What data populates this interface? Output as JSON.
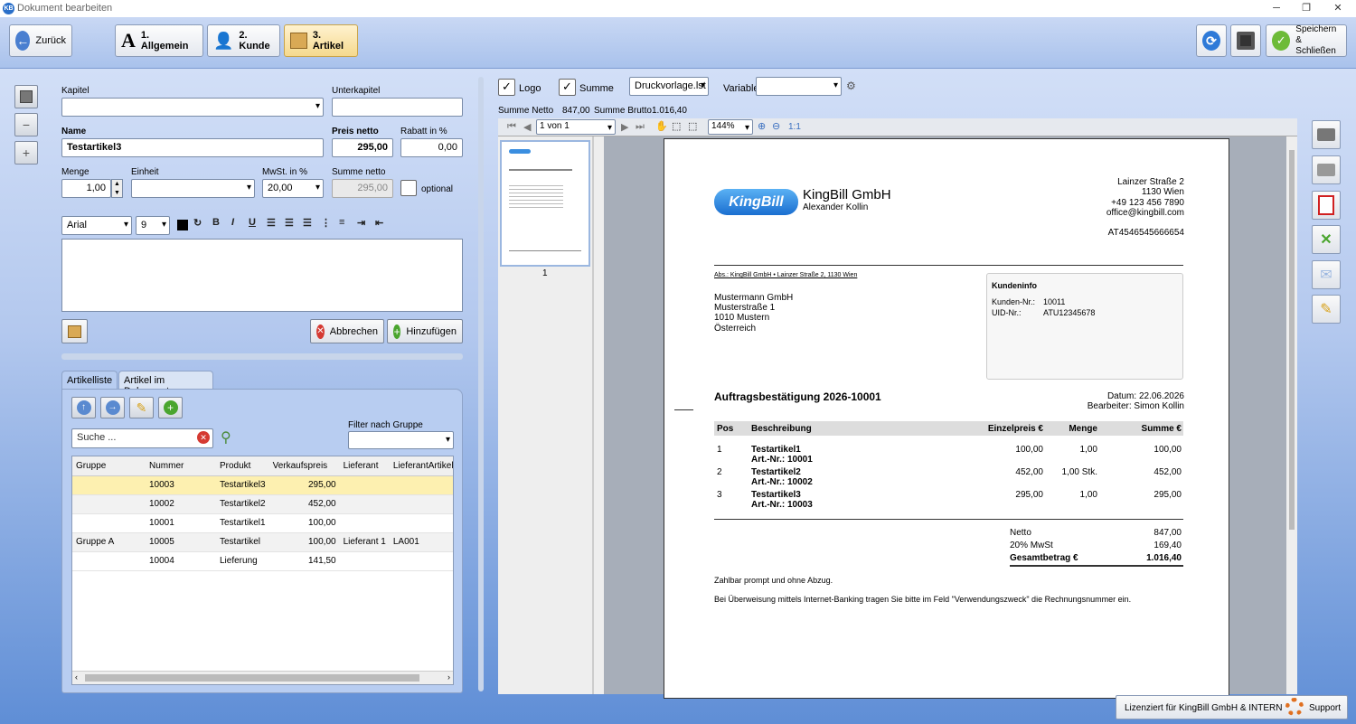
{
  "window": {
    "title": "Dokument bearbeiten",
    "app_icon": "KB"
  },
  "toolbar": {
    "back": "Zurück",
    "tab1": "1. Allgemein",
    "tab2": "2. Kunde",
    "tab3": "3. Artikel",
    "save": "Speichern",
    "save2": "& Schließen"
  },
  "form": {
    "kapitel_label": "Kapitel",
    "kapitel_value": "",
    "unterkapitel_label": "Unterkapitel",
    "unterkapitel_value": "",
    "name_label": "Name",
    "name_value": "Testartikel3",
    "preis_label": "Preis netto",
    "preis_value": "295,00",
    "rabatt_label": "Rabatt in %",
    "rabatt_value": "0,00",
    "menge_label": "Menge",
    "menge_value": "1,00",
    "einheit_label": "Einheit",
    "einheit_value": "",
    "mwst_label": "MwSt. in %",
    "mwst_value": "20,00",
    "summe_label": "Summe netto",
    "summe_value": "295,00",
    "optional_label": "optional",
    "font_value": "Arial",
    "size_value": "9",
    "cancel": "Abbrechen",
    "add": "Hinzufügen"
  },
  "list": {
    "tab1": "Artikelliste",
    "tab2": "Artikel im Dokument",
    "search_placeholder": "Suche ...",
    "filter_label": "Filter nach Gruppe",
    "columns": [
      "Gruppe",
      "Nummer",
      "Produkt",
      "Verkaufspreis",
      "Lieferant",
      "LieferantArtikelNu"
    ],
    "rows": [
      [
        "",
        "10003",
        "Testartikel3",
        "295,00",
        "",
        ""
      ],
      [
        "",
        "10002",
        "Testartikel2",
        "452,00",
        "",
        ""
      ],
      [
        "",
        "10001",
        "Testartikel1",
        "100,00",
        "",
        ""
      ],
      [
        "Gruppe A",
        "10005",
        "Testartikel",
        "100,00",
        "Lieferant 1",
        "LA001"
      ],
      [
        "",
        "10004",
        "Lieferung",
        "141,50",
        "",
        ""
      ]
    ]
  },
  "preview": {
    "logo_label": "Logo",
    "summe_label": "Summe",
    "template": "Druckvorlage.lst",
    "variable_label": "Variable",
    "summe_netto_label": "Summe Netto",
    "summe_netto": "847,00",
    "summe_brutto_label": "Summe Brutto",
    "summe_brutto": "1.016,40",
    "page": "1 von 1",
    "zoom": "144%",
    "ratio": "1:1",
    "thumb_num": "1"
  },
  "doc": {
    "logo": "KingBill",
    "company": "KingBill GmbH",
    "person": "Alexander Kollin",
    "addr1": "Lainzer Straße 2",
    "addr2": "1130 Wien",
    "phone": "+49 123 456 7890",
    "email": "office@kingbill.com",
    "uid": "AT4546545666654",
    "sender": "Abs.: KingBill GmbH • Lainzer Straße 2, 1130 Wien",
    "rc1": "Mustermann GmbH",
    "rc2": "Musterstraße 1",
    "rc3": "1010 Mustern",
    "rc4": "Österreich",
    "info_title": "Kundeninfo",
    "kn_label": "Kunden-Nr.:",
    "kn": "10011",
    "uid_label": "UID-Nr.:",
    "cuid": "ATU12345678",
    "title": "Auftragsbestätigung 2026-10001",
    "date": "Datum: 22.06.2026",
    "editor": "Bearbeiter: Simon Kollin",
    "cols": [
      "Pos",
      "Beschreibung",
      "Einzelpreis €",
      "Menge",
      "Summe €"
    ],
    "items": [
      {
        "pos": "1",
        "name": "Testartikel1",
        "art": "Art.-Nr.: 10001",
        "price": "100,00",
        "qty": "1,00",
        "sum": "100,00"
      },
      {
        "pos": "2",
        "name": "Testartikel2",
        "art": "Art.-Nr.: 10002",
        "price": "452,00",
        "qty": "1,00 Stk.",
        "sum": "452,00"
      },
      {
        "pos": "3",
        "name": "Testartikel3",
        "art": "Art.-Nr.: 10003",
        "price": "295,00",
        "qty": "1,00",
        "sum": "295,00"
      }
    ],
    "netto_label": "Netto",
    "netto": "847,00",
    "mwst_label": "20% MwSt",
    "mwst": "169,40",
    "total_label": "Gesamtbetrag €",
    "total": "1.016,40",
    "note1": "Zahlbar prompt und ohne Abzug.",
    "note2": "Bei Überweisung mittels Internet-Banking tragen Sie bitte im Feld \"Verwendungszweck\" die Rechnungsnummer ein."
  },
  "status": {
    "license": "Lizenziert für KingBill GmbH & INTERN",
    "support": "Support"
  }
}
